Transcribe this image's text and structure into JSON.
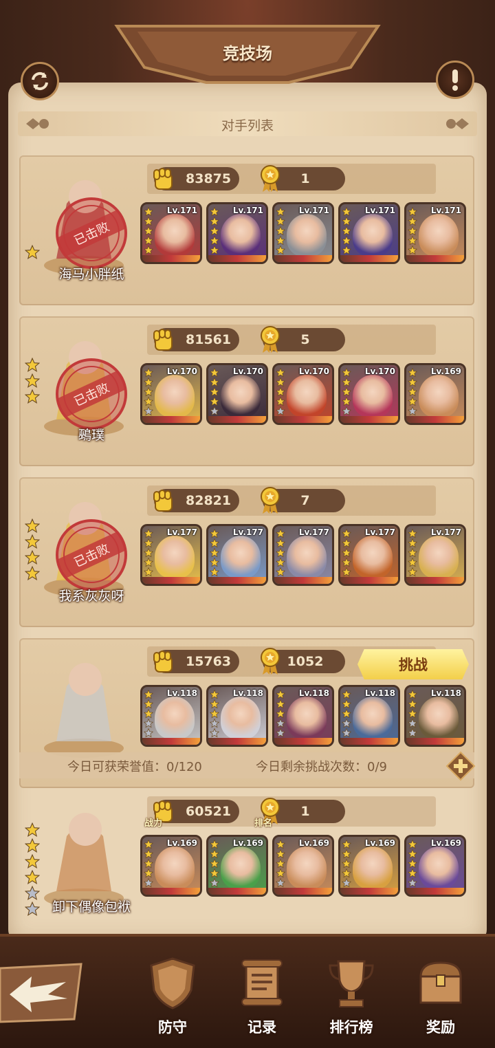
{
  "header": {
    "title": "竞技场",
    "subtitle": "对手列表"
  },
  "colors": {
    "accent": "#f3cf4a",
    "defeat_red": "#c23a3a",
    "panel": "#e9d5b6"
  },
  "opponents": [
    {
      "name": "海马小胖纸",
      "power": "83875",
      "rank": "1",
      "defeated": true,
      "defeated_label": "已击败",
      "stars": 1,
      "heroes": [
        {
          "level": "Lv.171",
          "stars": 5,
          "tone": "#b23a3a"
        },
        {
          "level": "Lv.171",
          "stars": 5,
          "tone": "#5a2f7a"
        },
        {
          "level": "Lv.171",
          "stars": 5,
          "tone": "#8a8f96"
        },
        {
          "level": "Lv.171",
          "stars": 5,
          "tone": "#4a3c8a"
        },
        {
          "level": "Lv.171",
          "stars": 5,
          "tone": "#c98c5a"
        }
      ]
    },
    {
      "name": "鵐璞",
      "power": "81561",
      "rank": "5",
      "defeated": true,
      "defeated_label": "已击败",
      "stars": 3,
      "heroes": [
        {
          "level": "Lv.170",
          "stars": 4,
          "tone": "#e3b94a"
        },
        {
          "level": "Lv.170",
          "stars": 4,
          "tone": "#3a2a3a"
        },
        {
          "level": "Lv.170",
          "stars": 4,
          "tone": "#c2442a"
        },
        {
          "level": "Lv.170",
          "stars": 4,
          "tone": "#b4365a"
        },
        {
          "level": "Lv.169",
          "stars": 4,
          "tone": "#c98c5a"
        }
      ]
    },
    {
      "name": "我系灰灰呀",
      "power": "82821",
      "rank": "7",
      "defeated": true,
      "defeated_label": "已击败",
      "stars": 4,
      "heroes": [
        {
          "level": "Lv.177",
          "stars": 5,
          "tone": "#e8c04a"
        },
        {
          "level": "Lv.177",
          "stars": 5,
          "tone": "#7a9ac8"
        },
        {
          "level": "Lv.177",
          "stars": 5,
          "tone": "#8a8aa8"
        },
        {
          "level": "Lv.177",
          "stars": 5,
          "tone": "#c2642a"
        },
        {
          "level": "Lv.177",
          "stars": 5,
          "tone": "#d8b050"
        }
      ]
    },
    {
      "name": "",
      "power": "15763",
      "rank": "1052",
      "defeated": false,
      "challenge_label": "挑战",
      "stars": 0,
      "heroes": [
        {
          "level": "Lv.118",
          "stars": 3,
          "tone": "#c8c8c8"
        },
        {
          "level": "Lv.118",
          "stars": 3,
          "tone": "#d0d0d8"
        },
        {
          "level": "Lv.118",
          "stars": 3,
          "tone": "#7a3a5a"
        },
        {
          "level": "Lv.118",
          "stars": 3,
          "tone": "#4a6a9a"
        },
        {
          "level": "Lv.118",
          "stars": 3,
          "tone": "#6a5a3a"
        }
      ]
    }
  ],
  "info_bar": {
    "honor": "今日可获荣誉值：0/120",
    "remaining": "今日剩余挑战次数：0/9"
  },
  "self": {
    "name": "卸下偶像包袱",
    "power": "60521",
    "rank": "1",
    "power_caption": "战力",
    "rank_caption": "排名",
    "heroes": [
      {
        "level": "Lv.169",
        "stars": 4,
        "tone": "#c98c5a"
      },
      {
        "level": "Lv.169",
        "stars": 4,
        "tone": "#4aa04a"
      },
      {
        "level": "Lv.169",
        "stars": 4,
        "tone": "#c98c5a"
      },
      {
        "level": "Lv.169",
        "stars": 4,
        "tone": "#d8a040"
      },
      {
        "level": "Lv.169",
        "stars": 4,
        "tone": "#6a4a9a"
      }
    ]
  },
  "nav": [
    {
      "label": "防守",
      "icon": "shield-icon"
    },
    {
      "label": "记录",
      "icon": "scroll-icon"
    },
    {
      "label": "排行榜",
      "icon": "trophy-icon"
    },
    {
      "label": "奖励",
      "icon": "treasure-chest-icon"
    }
  ]
}
